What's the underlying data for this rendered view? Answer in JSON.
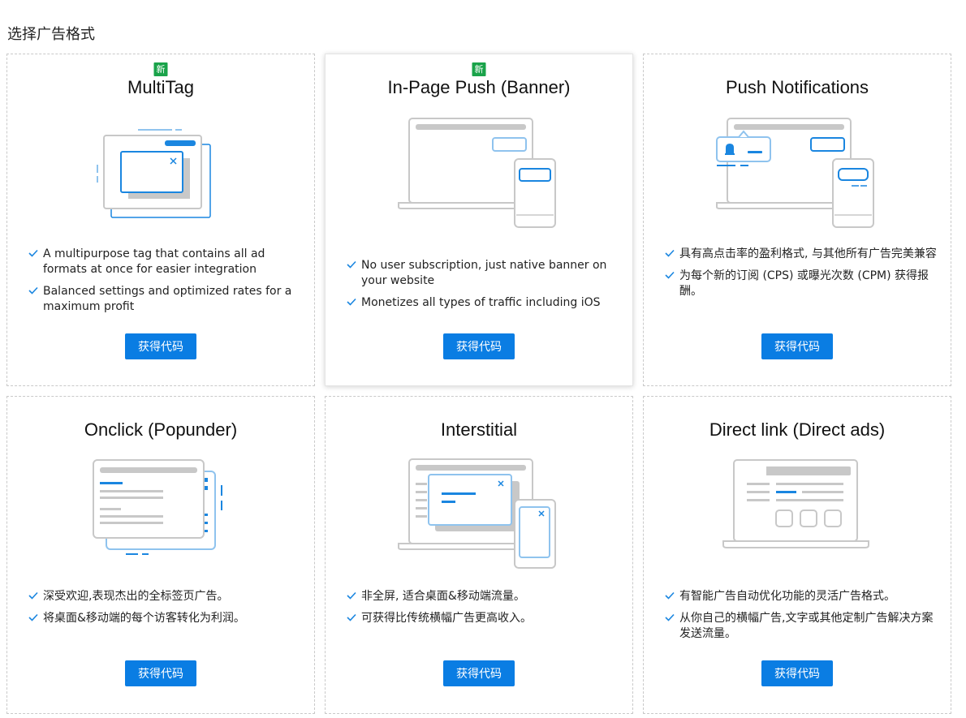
{
  "page": {
    "title": "选择广告格式"
  },
  "cards": [
    {
      "badge": "新",
      "title": "MultiTag",
      "features": [
        "A multipurpose tag that contains all ad formats at once for easier integration",
        "Balanced settings and optimized rates for a maximum profit"
      ],
      "button": "获得代码"
    },
    {
      "badge": "新",
      "title": "In-Page Push (Banner)",
      "features": [
        "No user subscription, just native banner on your website",
        "Monetizes all types of traffic including iOS"
      ],
      "button": "获得代码",
      "selected": true
    },
    {
      "title": "Push Notifications",
      "features": [
        "具有高点击率的盈利格式, 与其他所有广告完美兼容",
        "为每个新的订阅 (CPS) 或曝光次数 (CPM) 获得报酬。"
      ],
      "button": "获得代码"
    },
    {
      "title": "Onclick (Popunder)",
      "features": [
        "深受欢迎,表现杰出的全标签页广告。",
        "将桌面&移动端的每个访客转化为利润。"
      ],
      "button": "获得代码"
    },
    {
      "title": "Interstitial",
      "features": [
        "非全屏, 适合桌面&移动端流量。",
        "可获得比传统横幅广告更高收入。"
      ],
      "button": "获得代码"
    },
    {
      "title": "Direct link (Direct ads)",
      "features": [
        "有智能广告自动优化功能的灵活广告格式。",
        "从你自己的横幅广告,文字或其他定制广告解决方案发送流量。"
      ],
      "button": "获得代码"
    }
  ],
  "colors": {
    "accent": "#0a7de3",
    "badge": "#1aa34a",
    "illustration_gray": "#c8c8c8",
    "illustration_blue": "#1a86e0",
    "illustration_light_blue": "#8fc3ee"
  }
}
